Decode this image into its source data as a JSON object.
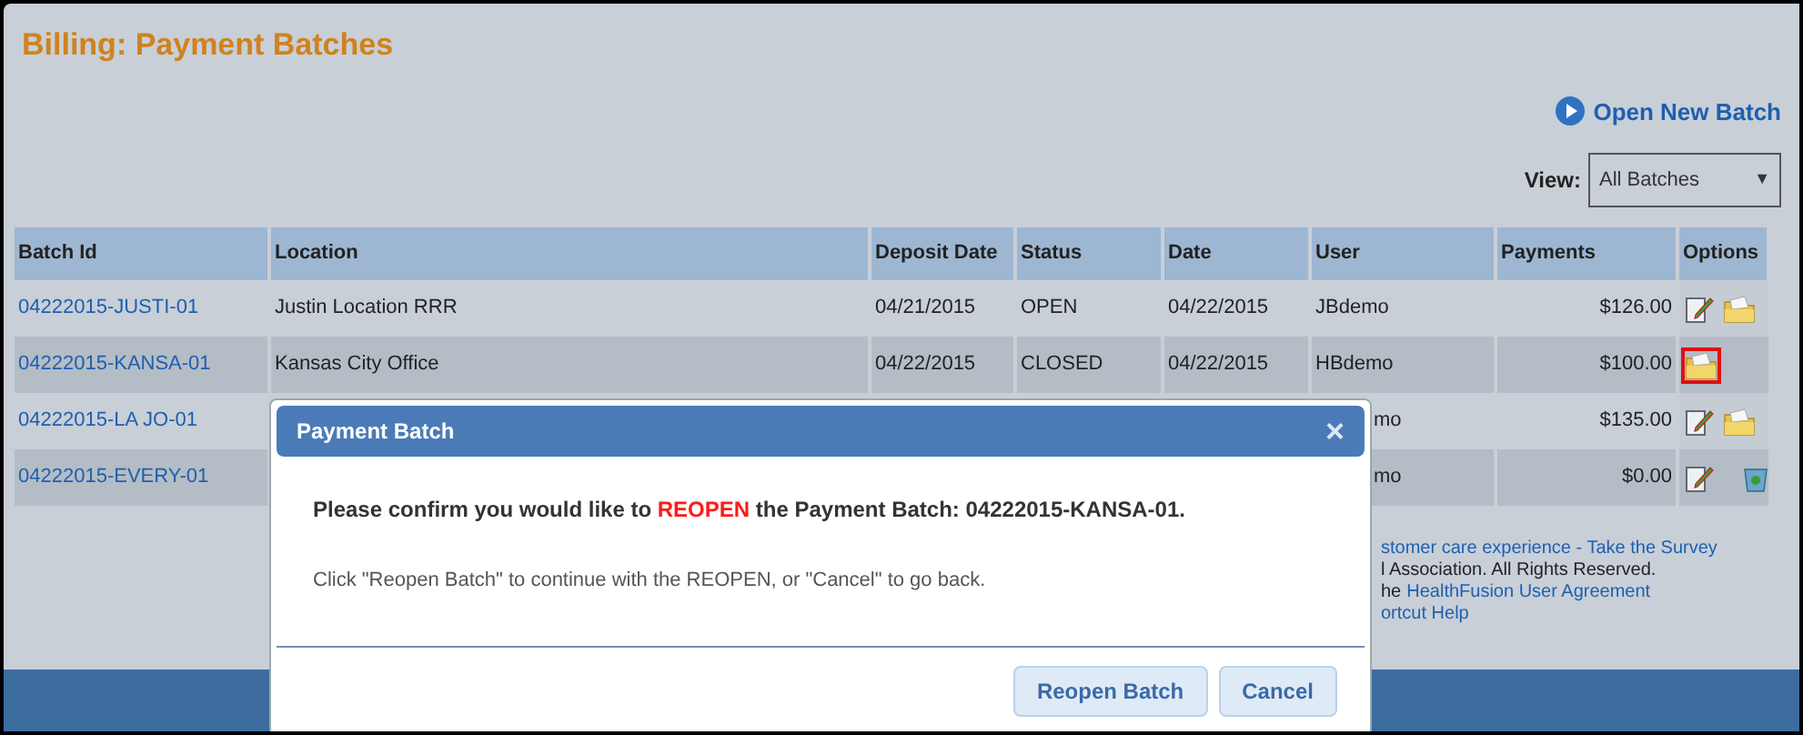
{
  "page_title": "Billing: Payment Batches",
  "open_new_batch": "Open New Batch",
  "view": {
    "label": "View:",
    "value": "All Batches",
    "caret": "▼"
  },
  "table": {
    "columns": [
      "Batch Id",
      "Location",
      "Deposit Date",
      "Status",
      "Date",
      "User",
      "Payments",
      "Options"
    ],
    "rows": [
      {
        "batch_id": "04222015-JUSTI-01",
        "location": "Justin Location RRR",
        "deposit_date": "04/21/2015",
        "status": "OPEN",
        "date": "04/22/2015",
        "user": "JBdemo",
        "payments": "$126.00",
        "options": [
          {
            "kind": "edit",
            "highlighted": false
          },
          {
            "kind": "folder",
            "highlighted": false
          }
        ]
      },
      {
        "batch_id": "04222015-KANSA-01",
        "location": "Kansas City Office",
        "deposit_date": "04/22/2015",
        "status": "CLOSED",
        "date": "04/22/2015",
        "user": "HBdemo",
        "payments": "$100.00",
        "options": [
          {
            "kind": "folder",
            "highlighted": true
          }
        ]
      },
      {
        "batch_id": "04222015-LA JO-01",
        "user": "mo",
        "payments": "$135.00",
        "options": [
          {
            "kind": "edit",
            "highlighted": false
          },
          {
            "kind": "folder",
            "highlighted": false
          }
        ]
      },
      {
        "batch_id": "04222015-EVERY-01",
        "user": "mo",
        "payments": "$0.00",
        "options": [
          {
            "kind": "edit",
            "highlighted": false
          },
          {
            "kind": "trash",
            "highlighted": false
          }
        ]
      }
    ]
  },
  "footer": {
    "survey_link": "stomer care experience - Take the Survey",
    "rights": "l Association. All Rights Reserved.",
    "agreement_prefix": "he",
    "agreement_link": "HealthFusion User Agreement",
    "shortcut_link": "ortcut Help"
  },
  "dialog": {
    "title": "Payment Batch",
    "close": "×",
    "message": "Please confirm you would like to **REOPEN** the Payment Batch: 04222015-KANSA-01.",
    "instructions": "Click \"Reopen Batch\" to continue with the REOPEN, or \"Cancel\" to go back.",
    "buttons": [
      "Reopen Batch",
      "Cancel"
    ]
  }
}
